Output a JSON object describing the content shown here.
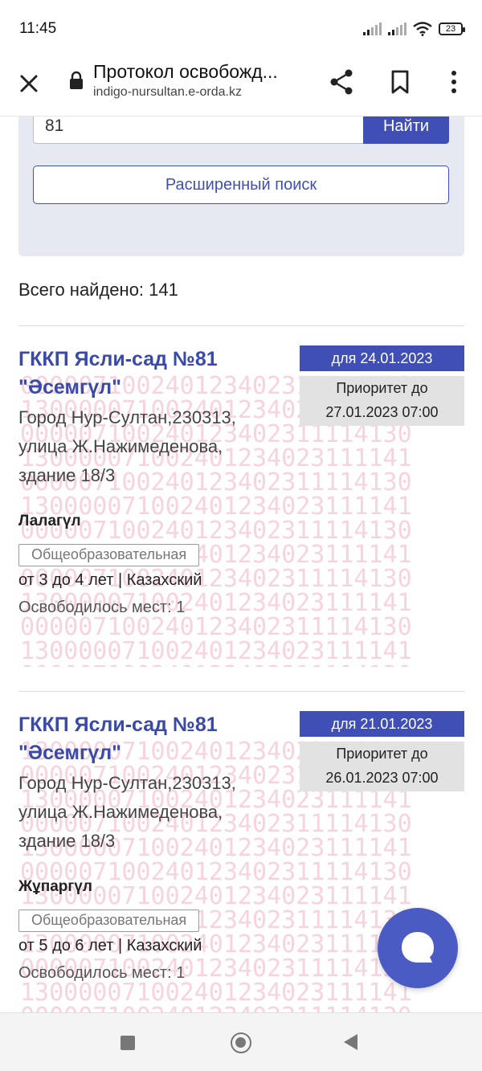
{
  "status": {
    "time": "11:45",
    "battery": "23"
  },
  "browser": {
    "title": "Протокол освобожд...",
    "url": "indigo-nursultan.e-orda.kz",
    "icons": [
      "close-icon",
      "lock-icon",
      "share-icon",
      "bookmark-icon",
      "more-vert-icon"
    ]
  },
  "search": {
    "value": "81",
    "button_label": "Найти",
    "advanced_label": "Расширенный поиск"
  },
  "results": {
    "total_label": "Всего найдено: 141",
    "watermark_text": "000007100240123402311114130",
    "watermark_text_alt": "130000071002401234023111141",
    "cards": [
      {
        "title_line1": "ГККП Ясли-сад №81",
        "title_line2": "\"Әсемгүл\"",
        "address_line1": "Город Нур-Султан,230313,",
        "address_line2": "улица Ж.Нажимеденова,",
        "address_line3": "здание 18/3",
        "date_badge": "для 24.01.2023",
        "priority_line1": "Приоритет до",
        "priority_line2": "27.01.2023 07:00",
        "group": "Лалагүл",
        "type": "Общеобразовательная",
        "age_lang": "от 3 до 4 лет | Казахский",
        "freed": "Освободилось мест: 1"
      },
      {
        "title_line1": "ГККП Ясли-сад №81",
        "title_line2": "\"Әсемгүл\"",
        "address_line1": "Город Нур-Султан,230313,",
        "address_line2": "улица Ж.Нажимеденова,",
        "address_line3": "здание 18/3",
        "date_badge": "для 21.01.2023",
        "priority_line1": "Приоритет до",
        "priority_line2": "26.01.2023 07:00",
        "group": "Жұпаргүл",
        "type": "Общеобразовательная",
        "age_lang": "от 5 до 6 лет | Казахский",
        "freed": "Освободилось мест: 1"
      }
    ]
  },
  "colors": {
    "accent": "#3f4fb5",
    "watermark": "#f7d3de",
    "panel": "#e6e9f2"
  }
}
